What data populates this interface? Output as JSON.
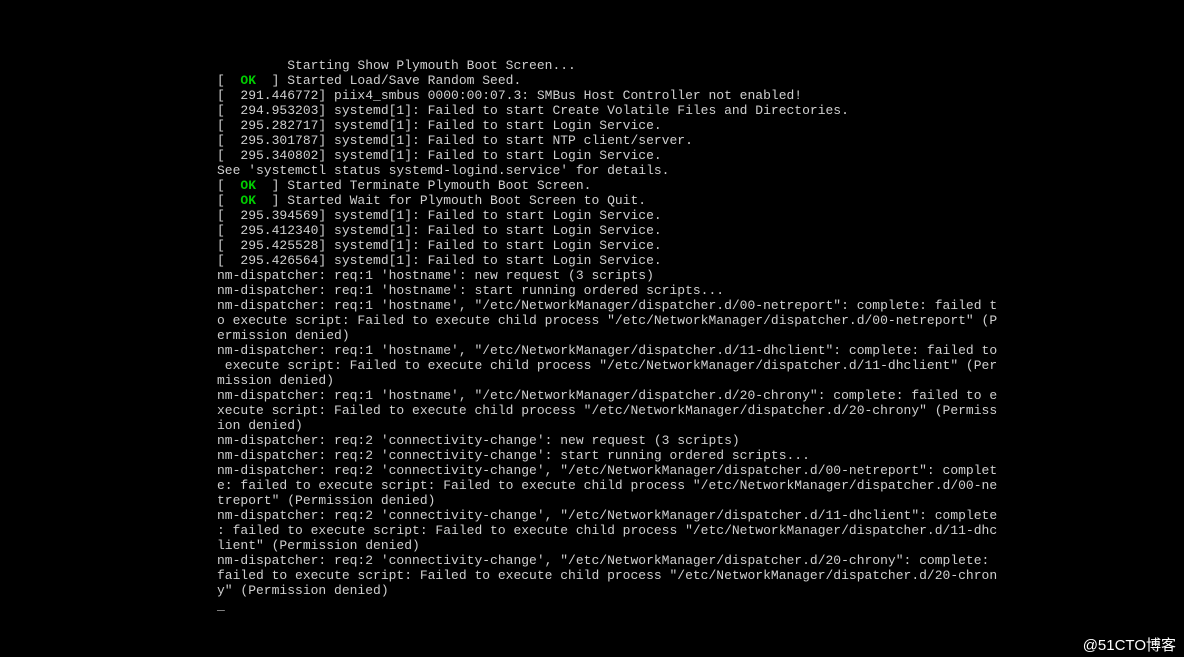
{
  "lines": [
    {
      "indent": "         ",
      "text": "Starting Show Plymouth Boot Screen..."
    },
    {
      "prefix": "[  ",
      "ok": "OK",
      "suffix": "  ] Started Load/Save Random Seed."
    },
    {
      "text": "[  291.446772] piix4_smbus 0000:00:07.3: SMBus Host Controller not enabled!"
    },
    {
      "text": "[  294.953203] systemd[1]: Failed to start Create Volatile Files and Directories."
    },
    {
      "text": "[  295.282717] systemd[1]: Failed to start Login Service."
    },
    {
      "text": "[  295.301787] systemd[1]: Failed to start NTP client/server."
    },
    {
      "text": "[  295.340802] systemd[1]: Failed to start Login Service."
    },
    {
      "text": "See 'systemctl status systemd-logind.service' for details."
    },
    {
      "prefix": "[  ",
      "ok": "OK",
      "suffix": "  ] Started Terminate Plymouth Boot Screen."
    },
    {
      "prefix": "[  ",
      "ok": "OK",
      "suffix": "  ] Started Wait for Plymouth Boot Screen to Quit."
    },
    {
      "text": "[  295.394569] systemd[1]: Failed to start Login Service."
    },
    {
      "text": "[  295.412340] systemd[1]: Failed to start Login Service."
    },
    {
      "text": "[  295.425528] systemd[1]: Failed to start Login Service."
    },
    {
      "text": "[  295.426564] systemd[1]: Failed to start Login Service."
    },
    {
      "text": "nm-dispatcher: req:1 'hostname': new request (3 scripts)"
    },
    {
      "text": "nm-dispatcher: req:1 'hostname': start running ordered scripts..."
    },
    {
      "text": "nm-dispatcher: req:1 'hostname', \"/etc/NetworkManager/dispatcher.d/00-netreport\": complete: failed t"
    },
    {
      "text": "o execute script: Failed to execute child process \"/etc/NetworkManager/dispatcher.d/00-netreport\" (P"
    },
    {
      "text": "ermission denied)"
    },
    {
      "text": "nm-dispatcher: req:1 'hostname', \"/etc/NetworkManager/dispatcher.d/11-dhclient\": complete: failed to"
    },
    {
      "text": " execute script: Failed to execute child process \"/etc/NetworkManager/dispatcher.d/11-dhclient\" (Per"
    },
    {
      "text": "mission denied)"
    },
    {
      "text": "nm-dispatcher: req:1 'hostname', \"/etc/NetworkManager/dispatcher.d/20-chrony\": complete: failed to e"
    },
    {
      "text": "xecute script: Failed to execute child process \"/etc/NetworkManager/dispatcher.d/20-chrony\" (Permiss"
    },
    {
      "text": "ion denied)"
    },
    {
      "text": "nm-dispatcher: req:2 'connectivity-change': new request (3 scripts)"
    },
    {
      "text": "nm-dispatcher: req:2 'connectivity-change': start running ordered scripts..."
    },
    {
      "text": "nm-dispatcher: req:2 'connectivity-change', \"/etc/NetworkManager/dispatcher.d/00-netreport\": complet"
    },
    {
      "text": "e: failed to execute script: Failed to execute child process \"/etc/NetworkManager/dispatcher.d/00-ne"
    },
    {
      "text": "treport\" (Permission denied)"
    },
    {
      "text": "nm-dispatcher: req:2 'connectivity-change', \"/etc/NetworkManager/dispatcher.d/11-dhclient\": complete"
    },
    {
      "text": ": failed to execute script: Failed to execute child process \"/etc/NetworkManager/dispatcher.d/11-dhc"
    },
    {
      "text": "lient\" (Permission denied)"
    },
    {
      "text": "nm-dispatcher: req:2 'connectivity-change', \"/etc/NetworkManager/dispatcher.d/20-chrony\": complete: "
    },
    {
      "text": "failed to execute script: Failed to execute child process \"/etc/NetworkManager/dispatcher.d/20-chron"
    },
    {
      "text": "y\" (Permission denied)"
    }
  ],
  "watermark": "@51CTO博客"
}
